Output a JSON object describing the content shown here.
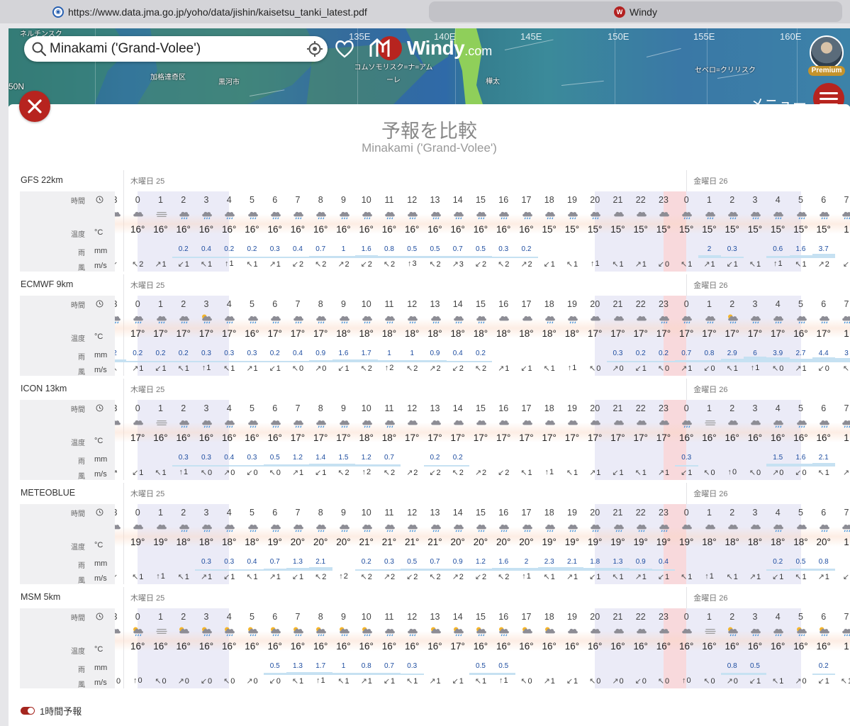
{
  "browser": {
    "tab1_url": "https://www.data.jma.go.jp/yoho/data/jishin/kaisetsu_tanki_latest.pdf",
    "tab2_title": "Windy",
    "tab1_icon": "jma-favicon",
    "tab2_icon": "windy-favicon"
  },
  "map": {
    "search_value": "Minakami ('Grand-Volee')",
    "logo_text": "Windy",
    "logo_suffix": "com",
    "premium_badge": "Premium",
    "menu_label": "メニュー",
    "grid_labels": [
      "135E",
      "140E",
      "145E",
      "150E",
      "155E",
      "160E"
    ],
    "place_labels": {
      "top_left": "ネルチンスク",
      "jiagedaqi": "加格達奇区",
      "heihe": "黒河市",
      "komsomolsk": "コムソモリスク=ナ=アムーレ",
      "karafuto": "樺太",
      "severo": "セベロ=クリリスク",
      "lat": "50N"
    }
  },
  "panel": {
    "title": "予報を比較",
    "subtitle": "Minakami ('Grand-Volee')",
    "toggle_label": "1時間予報",
    "row_labels": {
      "time": "時間",
      "temp": "温度",
      "temp_unit": "°C",
      "rain": "雨",
      "rain_unit": "mm",
      "wind": "風",
      "wind_unit": "m/s"
    },
    "days": {
      "thu": "木曜日 25",
      "fri": "金曜日 26"
    }
  },
  "hours": [
    "3",
    "0",
    "1",
    "2",
    "3",
    "4",
    "5",
    "6",
    "7",
    "8",
    "9",
    "10",
    "11",
    "12",
    "13",
    "14",
    "15",
    "16",
    "17",
    "18",
    "19",
    "20",
    "21",
    "22",
    "23",
    "0",
    "1",
    "2",
    "3",
    "4",
    "5",
    "6",
    "7"
  ],
  "models": [
    {
      "name": "GFS 22km",
      "icons": [
        "cloud",
        "cloud",
        "fog",
        "rain",
        "rain",
        "rain",
        "rain",
        "rain",
        "rain",
        "rain",
        "rain",
        "rain",
        "rain",
        "rain",
        "rain",
        "rain",
        "rain",
        "rain",
        "rain",
        "rain",
        "rain",
        "rain",
        "cloud",
        "cloud",
        "cloud",
        "rain",
        "rain",
        "rain",
        "rain",
        "rain",
        "rain",
        "rain",
        "rain"
      ],
      "temps": [
        "",
        "16°",
        "16°",
        "16°",
        "16°",
        "16°",
        "16°",
        "16°",
        "16°",
        "16°",
        "16°",
        "16°",
        "16°",
        "16°",
        "16°",
        "16°",
        "16°",
        "16°",
        "16°",
        "15°",
        "15°",
        "15°",
        "15°",
        "15°",
        "15°",
        "15°",
        "15°",
        "15°",
        "15°",
        "15°",
        "15°",
        "15°",
        "1"
      ],
      "rain": [
        "",
        "",
        "",
        "0.2",
        "0.4",
        "0.2",
        "0.2",
        "0.3",
        "0.4",
        "0.7",
        "1",
        "1.6",
        "0.8",
        "0.5",
        "0.5",
        "0.7",
        "0.5",
        "0.3",
        "0.2",
        "",
        "",
        "",
        "",
        "",
        "",
        "",
        "2",
        "0.3",
        "",
        "0.6",
        "1.6",
        "3.7",
        ""
      ],
      "wind": [
        "",
        "2",
        "1",
        "1",
        "1",
        "1",
        "1",
        "1",
        "2",
        "2",
        "2",
        "2",
        "2",
        "3",
        "2",
        "3",
        "2",
        "2",
        "2",
        "1",
        "1",
        "1",
        "1",
        "1",
        "0",
        "1",
        "1",
        "1",
        "1",
        "1",
        "1",
        "2",
        ""
      ]
    },
    {
      "name": "ECMWF 9km",
      "icons": [
        "rain",
        "rain",
        "rain",
        "rain",
        "sunrain",
        "rain",
        "rain",
        "rain",
        "rain",
        "rain",
        "rain",
        "rain",
        "rain",
        "rain",
        "rain",
        "rain",
        "rain",
        "cloud",
        "cloud",
        "rain",
        "rain",
        "cloud",
        "cloud",
        "cloud",
        "rain",
        "rain",
        "rain",
        "sunrain",
        "rain",
        "rain",
        "rain",
        "rain",
        "rain"
      ],
      "temps": [
        "",
        "17°",
        "17°",
        "17°",
        "17°",
        "17°",
        "16°",
        "17°",
        "17°",
        "17°",
        "18°",
        "18°",
        "18°",
        "18°",
        "18°",
        "18°",
        "18°",
        "18°",
        "18°",
        "18°",
        "18°",
        "17°",
        "17°",
        "17°",
        "17°",
        "17°",
        "17°",
        "17°",
        "17°",
        "17°",
        "16°",
        "17°",
        "1"
      ],
      "rain": [
        "2",
        "0.2",
        "0.2",
        "0.2",
        "0.3",
        "0.3",
        "0.3",
        "0.2",
        "0.4",
        "0.9",
        "1.6",
        "1.7",
        "1",
        "1",
        "0.9",
        "0.4",
        "0.2",
        "",
        "",
        "",
        "",
        "",
        "0.3",
        "0.2",
        "0.2",
        "0.7",
        "0.8",
        "2.9",
        "6",
        "3.9",
        "2.7",
        "4.4",
        "3"
      ],
      "wind": [
        "",
        "1",
        "1",
        "1",
        "1",
        "1",
        "1",
        "1",
        "0",
        "0",
        "1",
        "2",
        "2",
        "2",
        "2",
        "2",
        "2",
        "1",
        "1",
        "1",
        "1",
        "0",
        "0",
        "1",
        "0",
        "1",
        "0",
        "1",
        "1",
        "0",
        "1",
        "0",
        ""
      ]
    },
    {
      "name": "ICON 13km",
      "icons": [
        "cloud",
        "cloud",
        "fog",
        "rain",
        "rain",
        "rain",
        "rain",
        "rain",
        "rain",
        "rain",
        "rain",
        "rain",
        "rain",
        "cloud",
        "cloud",
        "cloud",
        "cloud",
        "cloud",
        "cloud",
        "cloud",
        "cloud",
        "cloud",
        "cloud",
        "cloud",
        "cloud",
        "rain",
        "fog",
        "cloud",
        "cloud",
        "rain",
        "rain",
        "rain",
        "rain"
      ],
      "temps": [
        "",
        "17°",
        "16°",
        "16°",
        "16°",
        "16°",
        "16°",
        "16°",
        "17°",
        "17°",
        "17°",
        "18°",
        "18°",
        "17°",
        "17°",
        "17°",
        "17°",
        "17°",
        "17°",
        "17°",
        "17°",
        "17°",
        "17°",
        "17°",
        "17°",
        "16°",
        "16°",
        "16°",
        "16°",
        "16°",
        "16°",
        "16°",
        "1"
      ],
      "rain": [
        "",
        "",
        "",
        "0.3",
        "0.3",
        "0.4",
        "0.3",
        "0.5",
        "1.2",
        "1.4",
        "1.5",
        "1.2",
        "0.7",
        "",
        "0.2",
        "0.2",
        "",
        "",
        "",
        "",
        "",
        "",
        "",
        "",
        "",
        "0.3",
        "",
        "",
        "",
        "1.5",
        "1.6",
        "2.1",
        ""
      ],
      "wind": [
        "",
        "1",
        "1",
        "1",
        "0",
        "0",
        "0",
        "0",
        "1",
        "1",
        "2",
        "2",
        "2",
        "2",
        "2",
        "2",
        "2",
        "2",
        "1",
        "1",
        "1",
        "1",
        "1",
        "1",
        "1",
        "1",
        "0",
        "0",
        "0",
        "0",
        "0",
        "1",
        ""
      ]
    },
    {
      "name": "METEOBLUE",
      "icons": [
        "cloud",
        "cloud",
        "cloud",
        "rain",
        "rain",
        "rain",
        "rain",
        "rain",
        "rain",
        "rain",
        "rain",
        "rain",
        "rain",
        "rain",
        "rain",
        "rain",
        "rain",
        "rain",
        "rain",
        "rain",
        "rain",
        "rain",
        "rain",
        "rain",
        "rain",
        "cloud",
        "cloud",
        "cloud",
        "cloud",
        "rain",
        "cloud",
        "rain",
        "rain"
      ],
      "temps": [
        "",
        "19°",
        "19°",
        "18°",
        "18°",
        "18°",
        "18°",
        "19°",
        "20°",
        "20°",
        "20°",
        "21°",
        "21°",
        "21°",
        "21°",
        "20°",
        "20°",
        "20°",
        "20°",
        "19°",
        "19°",
        "19°",
        "19°",
        "19°",
        "19°",
        "19°",
        "18°",
        "18°",
        "18°",
        "18°",
        "18°",
        "20°",
        "1"
      ],
      "rain": [
        "",
        "",
        "",
        "",
        "0.3",
        "0.3",
        "0.4",
        "0.7",
        "1.3",
        "2.1",
        "",
        "0.2",
        "0.3",
        "0.5",
        "0.7",
        "0.9",
        "1.2",
        "1.6",
        "2",
        "2.3",
        "2.1",
        "1.8",
        "1.3",
        "0.9",
        "0.4",
        "",
        "",
        "",
        "",
        "0.2",
        "0.5",
        "0.8",
        ""
      ],
      "wind": [
        "",
        "1",
        "1",
        "1",
        "1",
        "1",
        "1",
        "1",
        "1",
        "2",
        "2",
        "2",
        "2",
        "2",
        "2",
        "2",
        "2",
        "2",
        "1",
        "1",
        "1",
        "1",
        "1",
        "1",
        "1",
        "1",
        "1",
        "1",
        "1",
        "1",
        "1",
        "1",
        ""
      ]
    },
    {
      "name": "MSM 5km",
      "icons": [
        "cloud",
        "sunrain",
        "fog",
        "suncloud",
        "sunrain",
        "sunrain",
        "sunrain",
        "sunrain",
        "sunrain",
        "sunrain",
        "sunrain",
        "sunrain",
        "rain",
        "rain",
        "suncloud",
        "sunrain",
        "sunrain",
        "sunrain",
        "suncloud",
        "suncloud",
        "cloud",
        "cloud",
        "cloud",
        "cloud",
        "cloud",
        "cloud",
        "fog",
        "sunrain",
        "rain",
        "rain",
        "sunrain",
        "sunrain",
        "rain"
      ],
      "temps": [
        "",
        "16°",
        "16°",
        "16°",
        "16°",
        "16°",
        "16°",
        "16°",
        "16°",
        "16°",
        "16°",
        "16°",
        "16°",
        "16°",
        "16°",
        "17°",
        "16°",
        "16°",
        "16°",
        "16°",
        "16°",
        "16°",
        "16°",
        "16°",
        "16°",
        "16°",
        "16°",
        "16°",
        "16°",
        "16°",
        "16°",
        "16°",
        "1"
      ],
      "rain": [
        "",
        "",
        "",
        "",
        "",
        "",
        "",
        "0.5",
        "1.3",
        "1.7",
        "1",
        "0.8",
        "0.7",
        "0.3",
        "",
        "",
        "0.5",
        "0.5",
        "",
        "",
        "",
        "",
        "",
        "",
        "",
        "",
        "",
        "0.8",
        "0.5",
        "",
        "",
        "0.2",
        ""
      ],
      "wind": [
        "0",
        "0",
        "0",
        "0",
        "0",
        "0",
        "0",
        "0",
        "1",
        "1",
        "1",
        "1",
        "1",
        "1",
        "1",
        "1",
        "1",
        "1",
        "0",
        "1",
        "1",
        "0",
        "0",
        "0",
        "0",
        "0",
        "0",
        "0",
        "1",
        "1",
        "0",
        "1",
        "1"
      ]
    }
  ],
  "colors": {
    "accent": "#b7241f",
    "night_shade": "#ebebf7",
    "now_shade": "#f8d9dc",
    "rain_text": "#1e4da0"
  }
}
